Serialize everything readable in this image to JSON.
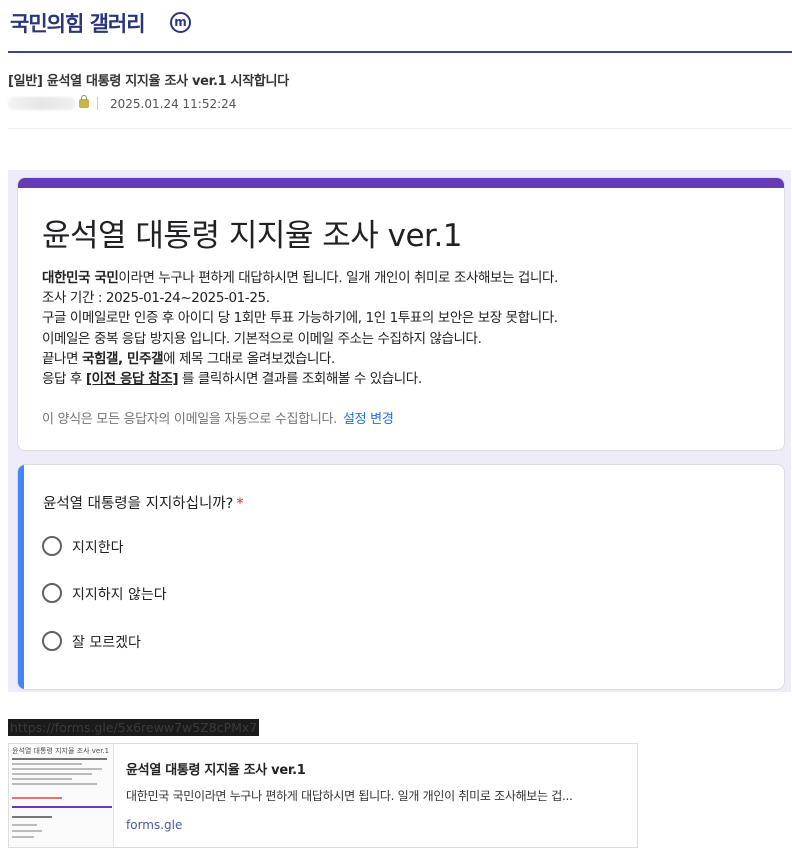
{
  "gallery": {
    "title": "국민의힘 갤러리",
    "badge": "m"
  },
  "post": {
    "title": "[일반] 윤석열 대통령 지지율 조사 ver.1 시작합니다",
    "date": "2025.01.24 11:52:24"
  },
  "form": {
    "title": "윤석열 대통령 지지율 조사 ver.1",
    "desc": {
      "line1_bold": "대한민국 국민",
      "line1_rest": "이라면 누구나 편하게 대답하시면 됩니다. 일개 개인이 취미로 조사해보는 겁니다.",
      "line2": "조사 기간 : 2025-01-24~2025-01-25.",
      "line3": "구글 이메일로만 인증 후 아이디 당 1회만 투표 가능하기에, 1인 1투표의 보안은 보장 못합니다.",
      "line4": "이메일은 중복 응답 방지용 입니다. 기본적으로 이메일 주소는 수집하지 않습니다.",
      "line5_pre": "끝나면 ",
      "line5_bold1": "국힘갤",
      "line5_mid": ", ",
      "line5_bold2": "민주갤",
      "line5_post": "에 제목 그대로 올려보겠습니다.",
      "line6_pre": "응답 후 ",
      "line6_bold": "[이전 응답 참조]",
      "line6_post": " 를 클릭하시면 결과를 조회해볼 수 있습니다."
    },
    "email_notice": "이 양식은 모든 응답자의 이메일을 자동으로 수집합니다.",
    "settings_link": "설정 변경",
    "question": {
      "title": "윤석열 대통령을 지지하십니까?",
      "required_mark": "*",
      "options": [
        "지지한다",
        "지지하지 않는다",
        "잘 모르겠다"
      ]
    }
  },
  "share": {
    "url": "https://forms.gle/5x6reww7w5Z8cPMx7"
  },
  "preview": {
    "thumb_title": "윤석열 대통령 지지율 조사 ver.1",
    "title": "윤석열 대통령 지지율 조사 ver.1",
    "desc": "대한민국 국민이라면 누구나 편하게 대답하시면 됩니다. 일개 개인이 취미로 조사해보는 겁...",
    "domain": "forms.gle"
  },
  "colors": {
    "brand": "#29367c",
    "form_accent": "#673ab7",
    "question_accent": "#4285f4",
    "link": "#1a73e8",
    "required": "#d93025"
  }
}
